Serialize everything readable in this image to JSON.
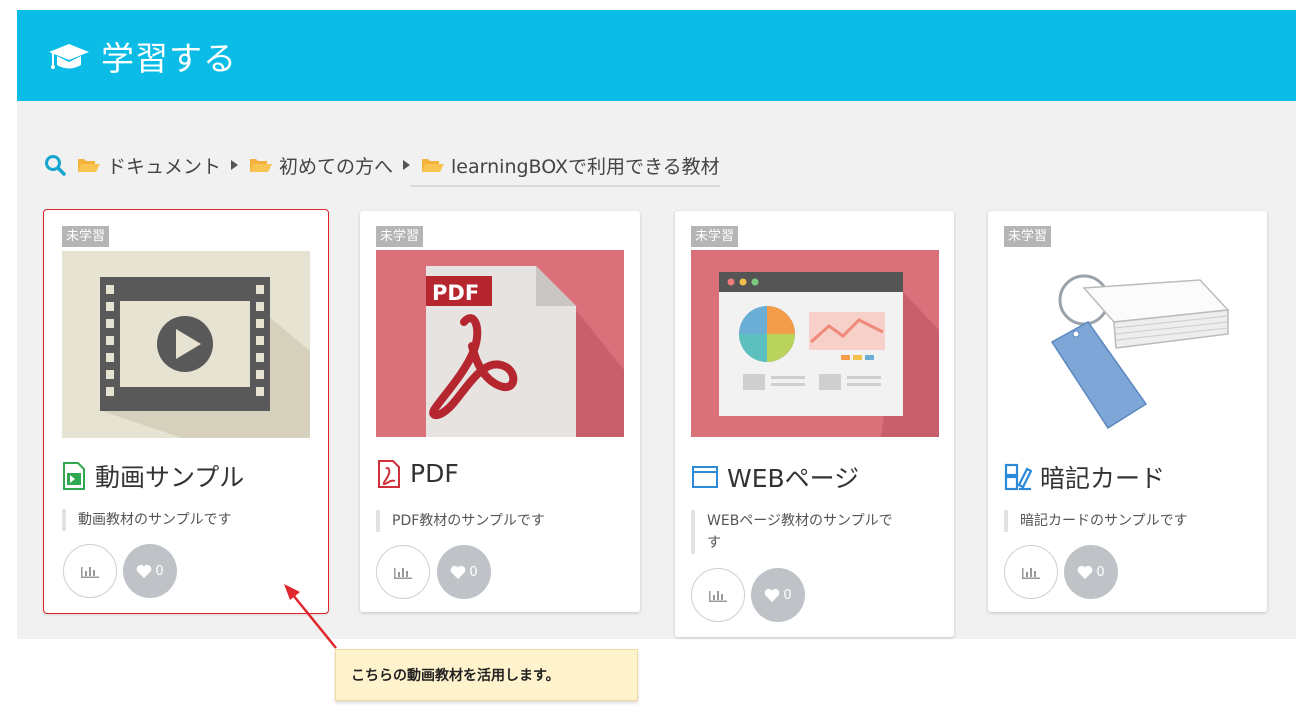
{
  "header": {
    "title": "学習する",
    "icon": "graduation-cap-icon",
    "color": "#0bbde6"
  },
  "breadcrumb": {
    "items": [
      "ドキュメント",
      "初めての方へ",
      "learningBOXで利用できる教材"
    ]
  },
  "cards": [
    {
      "badge": "未学習",
      "title": "動画サンプル",
      "icon": "video-file-icon",
      "description": "動画教材のサンプルです",
      "likes": "0"
    },
    {
      "badge": "未学習",
      "title": "PDF",
      "icon": "pdf-file-icon",
      "description": "PDF教材のサンプルです",
      "likes": "0"
    },
    {
      "badge": "未学習",
      "title": "WEBページ",
      "icon": "web-window-icon",
      "description": "WEBページ教材のサンプルです",
      "likes": "0"
    },
    {
      "badge": "未学習",
      "title": "暗記カード",
      "icon": "flashcard-icon",
      "description": "暗記カードのサンプルです",
      "likes": "0"
    }
  ],
  "callout": {
    "text": "こちらの動画教材を活用します。"
  }
}
